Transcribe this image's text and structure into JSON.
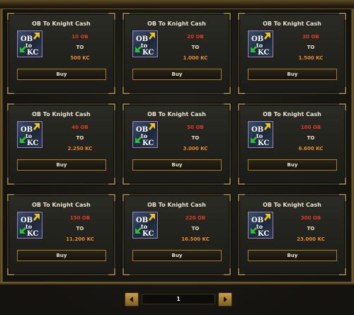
{
  "offers": [
    {
      "title": "OB To Knight Cash",
      "ob": "10 OB",
      "to": "TO",
      "kc": "500 KC",
      "buy": "Buy"
    },
    {
      "title": "OB To Knight Cash",
      "ob": "20 OB",
      "to": "TO",
      "kc": "1.000 KC",
      "buy": "Buy"
    },
    {
      "title": "OB To Knight Cash",
      "ob": "30 OB",
      "to": "TO",
      "kc": "1.500 KC",
      "buy": "Buy"
    },
    {
      "title": "OB To Knight Cash",
      "ob": "40 OB",
      "to": "TO",
      "kc": "2.250 KC",
      "buy": "Buy"
    },
    {
      "title": "OB To Knight Cash",
      "ob": "50 OB",
      "to": "TO",
      "kc": "3.000 KC",
      "buy": "Buy"
    },
    {
      "title": "OB To Knight Cash",
      "ob": "100 OB",
      "to": "TO",
      "kc": "6.600 KC",
      "buy": "Buy"
    },
    {
      "title": "OB To Knight Cash",
      "ob": "150 OB",
      "to": "TO",
      "kc": "11.200 KC",
      "buy": "Buy"
    },
    {
      "title": "OB To Knight Cash",
      "ob": "220 OB",
      "to": "TO",
      "kc": "16.500 KC",
      "buy": "Buy"
    },
    {
      "title": "OB To Knight Cash",
      "ob": "300 OB",
      "to": "TO",
      "kc": "23.000 KC",
      "buy": "Buy"
    }
  ],
  "icon": {
    "name": "ob-to-kc-icon",
    "line1": "OB",
    "line2": "to",
    "line3": "KC"
  },
  "pagination": {
    "page": "1"
  },
  "colors": {
    "ob": "#e03a22",
    "kc": "#e88a2a",
    "accent": "#a17a2a"
  }
}
